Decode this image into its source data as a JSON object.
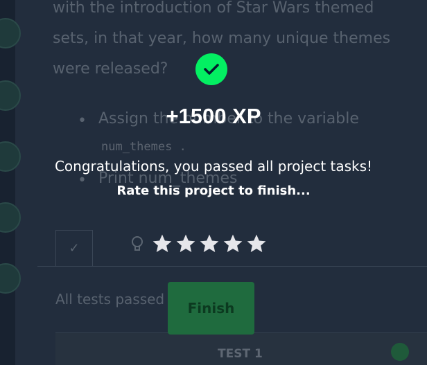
{
  "background": {
    "question_lines": [
      "with the introduction of Star Wars themed",
      "sets, in that year, how many unique themes",
      "were released?"
    ],
    "bullets": [
      {
        "text": "Assign the number to the variable"
      },
      {
        "text": "Print num_themes"
      }
    ],
    "code_var": "num_themes .",
    "tab_check": "✓",
    "status_text": "All tests passed",
    "test_label": "TEST 1"
  },
  "overlay": {
    "xp": "+1500 XP",
    "congrats": "Congratulations, you passed all project tasks!",
    "rate_prompt": "Rate this project to finish...",
    "rating": {
      "filled": 0,
      "max": 5
    },
    "finish_label": "Finish"
  },
  "colors": {
    "accent_green": "#03ef62",
    "overlay_bg": "#222d3d",
    "star_color": "#e6e6ea"
  }
}
